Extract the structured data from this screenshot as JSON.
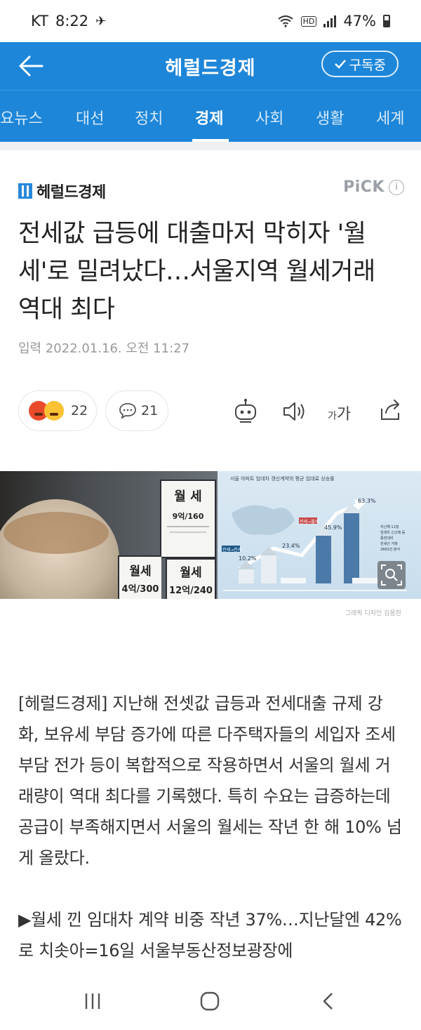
{
  "status_bar": {
    "carrier": "KT",
    "time": "8:22",
    "battery": "47%"
  },
  "header": {
    "title": "헤럴드경제",
    "subscribe_label": "구독중"
  },
  "nav": {
    "tabs": [
      "요뉴스",
      "대선",
      "정치",
      "경제",
      "사회",
      "생활",
      "세계"
    ],
    "active": "경제"
  },
  "article": {
    "press": "헤럴드경제",
    "pick_label": "PiCK",
    "pick_info": "i",
    "headline": "전세값 급등에 대출마저 막히자 '월세'로 밀려났다…서울지역 월세거래 역대 최다",
    "date": "입력 2022.01.16. 오전 11:27",
    "reaction_count": "22",
    "comment_count": "21",
    "font_small": "가",
    "font_large": "가",
    "caption": "그래픽 디자인 김용한",
    "paragraphs": [
      "[헤럴드경제] 지난해 전셋값 급등과 전세대출 규제 강화, 보유세 부담 증가에 따른 다주택자들의 세입자 조세 부담 전가 등이 복합적으로 작용하면서 서울의 월세 거래량이 역대 최다를 기록했다. 특히 수요는 급증하는데 공급이 부족해지면서 서울의 월세는 작년 한 해 10% 넘게 올랐다.",
      "▶월세 낀 임대차 계약 비중 작년 37%…지난달엔 42%로 치솟아=16일 서울부동산정보광장에"
    ]
  },
  "hero_image": {
    "sign1_title": "월 세",
    "sign1_value": "9억/160",
    "sign2_title": "월세",
    "sign2_value": "4억/300",
    "sign3_title": "월세",
    "sign3_value": "12억/240",
    "chart_title": "서울 아파트 임대차 갱신계약의 평균 임대료 상승률",
    "labels": [
      "전세→전세",
      "전세→월세"
    ],
    "values": [
      "10.2%",
      "23.4%",
      "45.9%",
      "63.3%"
    ],
    "note_lines": [
      "지난해 11월",
      "임대차 신고제 등",
      "종전대비",
      "전세인 거래",
      "2663건 분석"
    ]
  }
}
